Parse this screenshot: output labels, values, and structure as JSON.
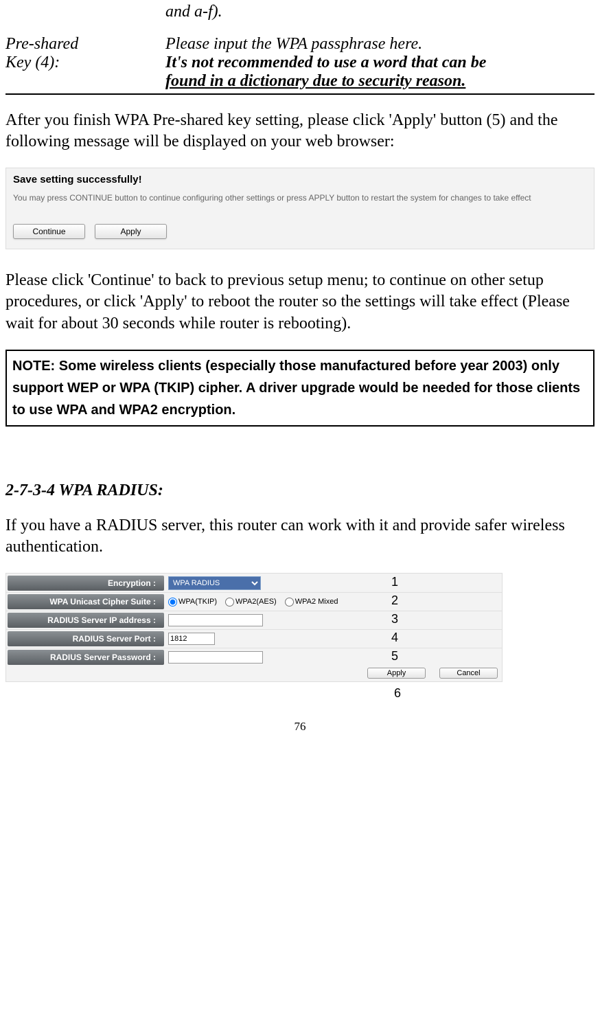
{
  "topFragment": "and a-f).",
  "tableRow": {
    "labelLine1": "Pre-shared",
    "labelLine2": "Key (4):",
    "descLine1": "Please input the WPA passphrase here.",
    "descLine2": "It's not recommended to use a word that can be",
    "descLine3": "found in a dictionary due to security reason."
  },
  "para1": "After you finish WPA Pre-shared key setting, please click 'Apply' button (5) and the following message will be displayed on your web browser:",
  "msgBox": {
    "title": "Save setting successfully!",
    "desc": "You may press CONTINUE button to continue configuring other settings or press APPLY button to restart the system for changes to take effect",
    "continueBtn": "Continue",
    "applyBtn": "Apply"
  },
  "para2": "Please click 'Continue' to back to previous setup menu; to continue on other setup procedures, or click 'Apply' to reboot the router so the settings will take effect (Please wait for about 30 seconds while router is rebooting).",
  "noteBox": "NOTE: Some wireless clients (especially those manufactured before year 2003) only support WEP or WPA (TKIP) cipher. A driver upgrade would be needed for those clients to use WPA and WPA2 encryption.",
  "sectionTitle": "2-7-3-4 WPA RADIUS:",
  "para3": "If you have a RADIUS server, this router can work with it and provide safer wireless authentication.",
  "config": {
    "rows": {
      "encryption": {
        "label": "Encryption :",
        "value": "WPA RADIUS"
      },
      "cipher": {
        "label": "WPA Unicast Cipher Suite :",
        "opt1": "WPA(TKIP)",
        "opt2": "WPA2(AES)",
        "opt3": "WPA2 Mixed"
      },
      "ip": {
        "label": "RADIUS Server IP address :",
        "value": ""
      },
      "port": {
        "label": "RADIUS Server Port :",
        "value": "1812"
      },
      "password": {
        "label": "RADIUS Server Password :",
        "value": ""
      }
    },
    "applyBtn": "Apply",
    "cancelBtn": "Cancel"
  },
  "callouts": {
    "c1": "1",
    "c2": "2",
    "c3": "3",
    "c4": "4",
    "c5": "5",
    "c6": "6"
  },
  "pageNumber": "76"
}
